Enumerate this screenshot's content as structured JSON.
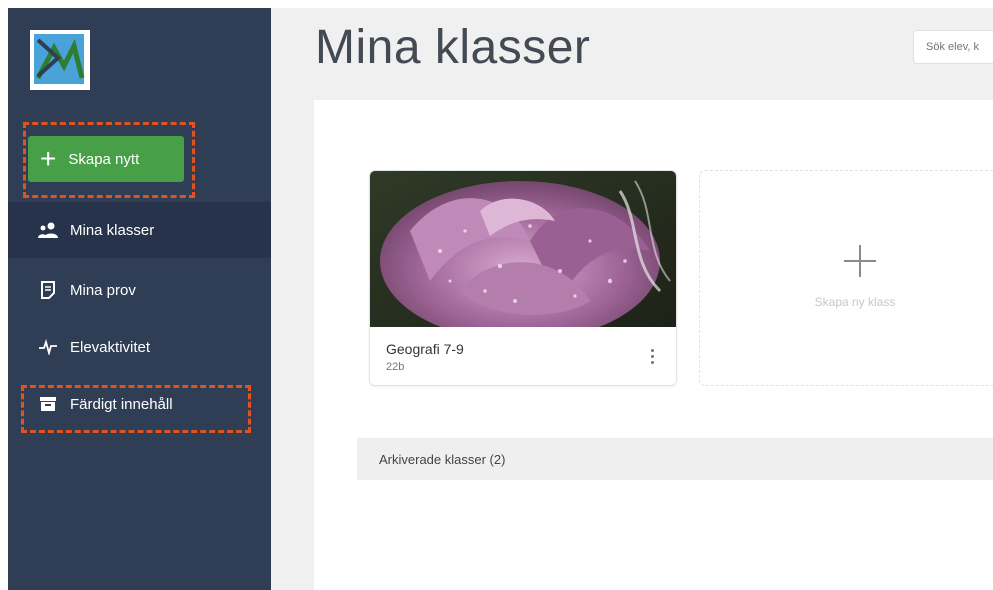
{
  "sidebar": {
    "create_label": "Skapa nytt",
    "items": [
      {
        "label": "Mina klasser",
        "icon": "users-icon",
        "active": true
      },
      {
        "label": "Mina prov",
        "icon": "document-icon",
        "active": false
      },
      {
        "label": "Elevaktivitet",
        "icon": "activity-icon",
        "active": false
      },
      {
        "label": "Färdigt innehåll",
        "icon": "archive-box-icon",
        "active": false
      }
    ]
  },
  "header": {
    "title": "Mina klasser",
    "search_placeholder": "Sök elev, k"
  },
  "classes": [
    {
      "name": "Geografi 7-9",
      "subtitle": "22b",
      "image": "pink-rose-with-water-drops"
    }
  ],
  "new_class_label": "Skapa ny klass",
  "archived_label": "Arkiverade klasser (2)",
  "colors": {
    "sidebar_bg": "#2f3e55",
    "sidebar_active": "#26334a",
    "create_button": "#47a047",
    "highlight_dash": "#e0531f",
    "main_bg": "#f0f0f0"
  }
}
